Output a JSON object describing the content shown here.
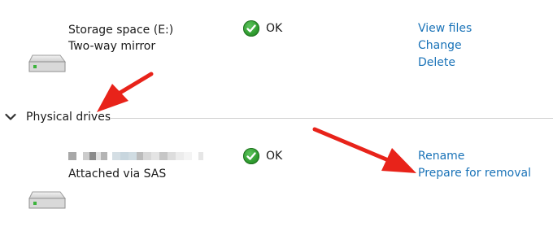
{
  "storage_space": {
    "name": "Storage space (E:)",
    "type": "Two-way mirror",
    "status": "OK",
    "links": [
      "View files",
      "Change",
      "Delete"
    ]
  },
  "physical_drives": {
    "section_label": "Physical drives",
    "drive": {
      "connection": "Attached via SAS",
      "status": "OK",
      "links": [
        "Rename",
        "Prepare for removal"
      ]
    }
  },
  "colors": {
    "link": "#1a73b8",
    "status_ok": "#2e9a2e",
    "annotation_arrow": "#e8231a"
  }
}
